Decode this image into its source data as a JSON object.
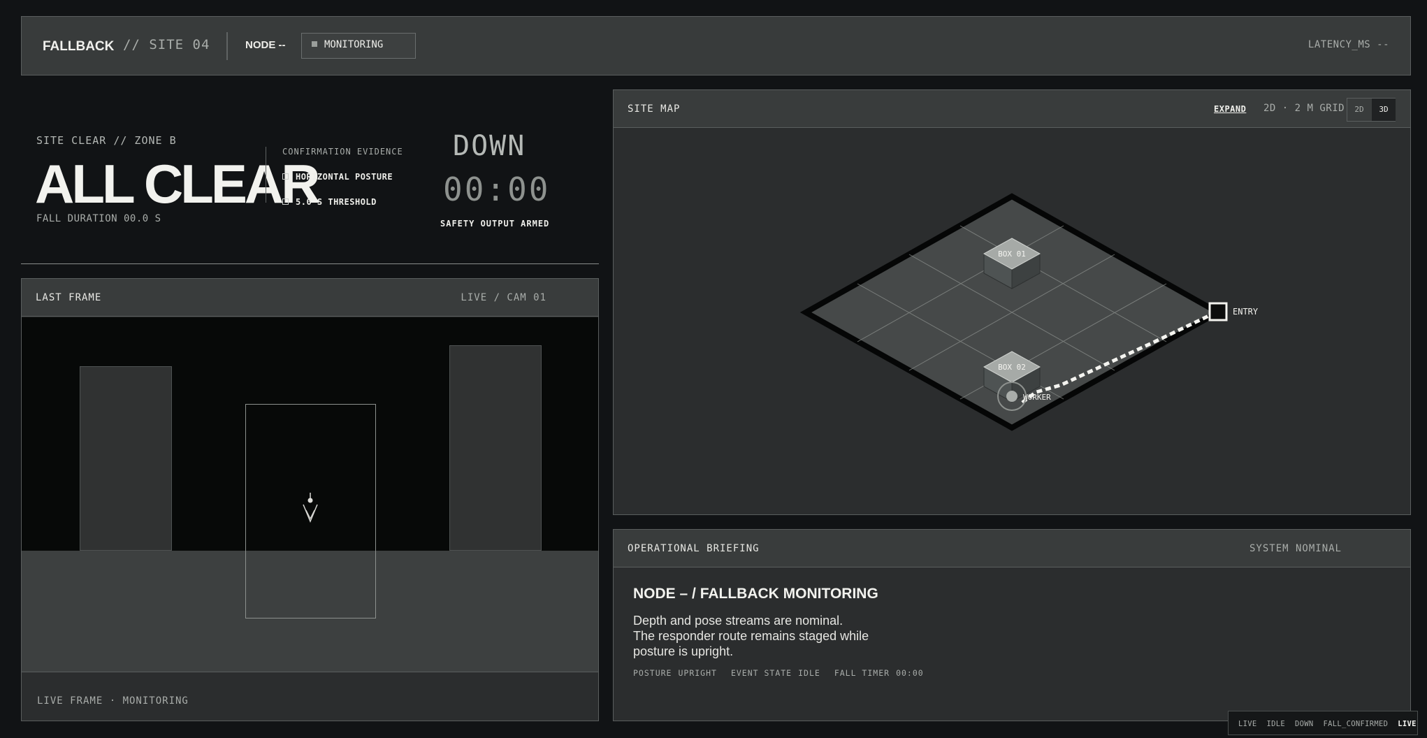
{
  "header": {
    "brand": "FALLBACK",
    "site": "// SITE 04",
    "node": "NODE --",
    "mode": "MONITORING",
    "latency": "LATENCY_MS --"
  },
  "status": {
    "zone": "SITE CLEAR // ZONE B",
    "headline": "ALL CLEAR",
    "fall_duration": "FALL DURATION 00.0 S",
    "evidence_title": "CONFIRMATION EVIDENCE",
    "evidence": [
      "HORIZONTAL POSTURE",
      "5.0 S THRESHOLD"
    ],
    "down_label": "DOWN",
    "timer": "00:00",
    "output": "SAFETY OUTPUT ARMED"
  },
  "last_frame": {
    "title": "LAST FRAME",
    "camera": "LIVE / CAM 01",
    "footer": "LIVE FRAME · MONITORING"
  },
  "site_map": {
    "title": "SITE MAP",
    "expand": "EXPAND",
    "grid": "2D · 2 M GRID",
    "view_2d": "2D",
    "view_3d": "3D",
    "box1": "BOX 01",
    "box2": "BOX 02",
    "entry": "ENTRY",
    "worker": "WORKER"
  },
  "briefing": {
    "title": "OPERATIONAL BRIEFING",
    "system": "SYSTEM NOMINAL",
    "headline": "NODE – / FALLBACK MONITORING",
    "lines": [
      "Depth and pose streams are nominal.",
      "The responder route remains staged while",
      "posture is upright."
    ],
    "posture_label": "POSTURE",
    "posture": "UPRIGHT",
    "event_label": "EVENT STATE",
    "event": "IDLE",
    "timer_label": "FALL TIMER",
    "timer": "00:00"
  },
  "state_bar": {
    "states": [
      "LIVE",
      "IDLE",
      "DOWN",
      "FALL_CONFIRMED"
    ],
    "active": "LIVE"
  }
}
